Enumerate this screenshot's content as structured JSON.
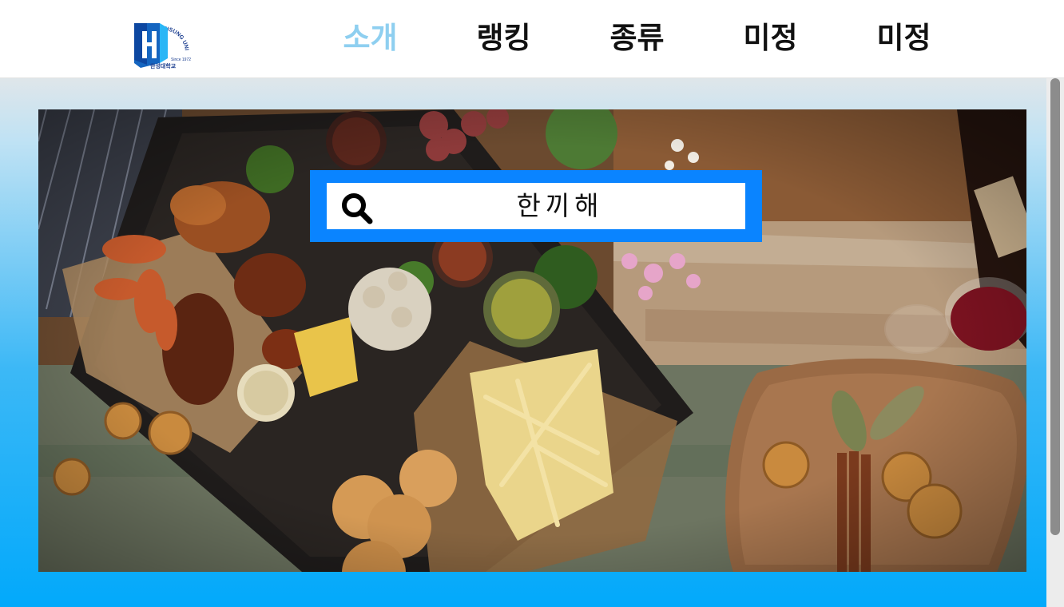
{
  "header": {
    "logo": {
      "icon": "hansung-university-logo-icon",
      "arc_text": "HANSUNG UNIVERSITY",
      "since_text": "Since 1972",
      "korean_text": "한성대학교"
    },
    "nav": [
      {
        "label": "소개",
        "active": true
      },
      {
        "label": "랭킹",
        "active": false
      },
      {
        "label": "종류",
        "active": false
      },
      {
        "label": "미정",
        "active": false
      },
      {
        "label": "미정",
        "active": false
      }
    ]
  },
  "hero": {
    "image": "food-table-photo"
  },
  "search": {
    "icon": "search-icon",
    "value": "한끼해"
  },
  "colors": {
    "accent_blue": "#0a84ff",
    "nav_active": "#8ecff0",
    "gradient_bottom": "#02a9fb"
  }
}
